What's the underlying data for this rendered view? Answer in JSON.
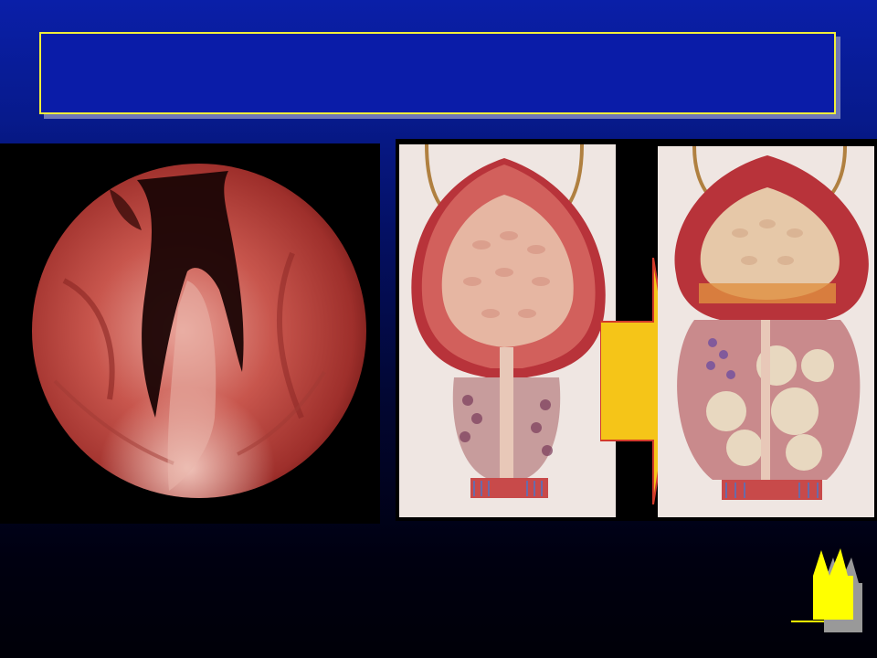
{
  "slide": {
    "title": "",
    "colors": {
      "background_top": "#0a1fa8",
      "background_bottom": "#000008",
      "title_border": "#f0ee3a",
      "title_fill": "#0a1ca8",
      "arrow": "#f5c518",
      "logo": "#ffff00"
    }
  },
  "images": {
    "left": {
      "icon": "endoscopic-view"
    },
    "right": [
      {
        "icon": "bladder-prostate-normal-illustration"
      },
      {
        "icon": "bladder-prostate-enlarged-illustration"
      }
    ],
    "arrow": {
      "icon": "right-arrow-icon"
    }
  },
  "logo": {
    "icon": "cathedral-logo-icon"
  }
}
